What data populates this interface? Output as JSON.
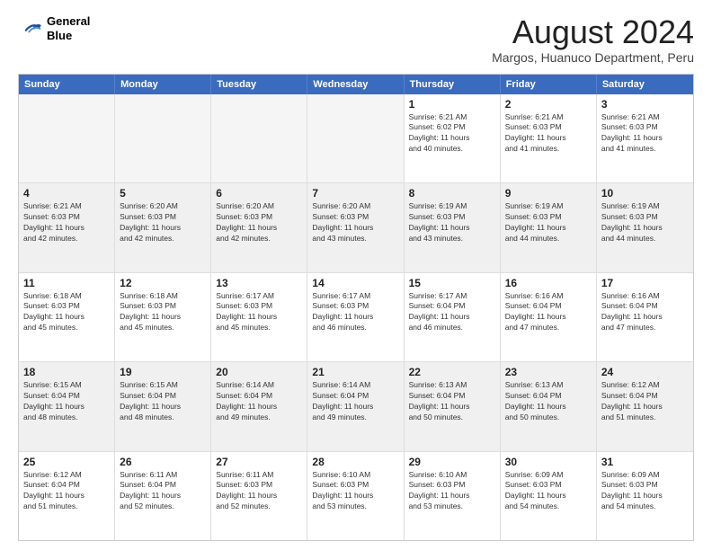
{
  "logo": {
    "line1": "General",
    "line2": "Blue"
  },
  "header": {
    "month": "August 2024",
    "location": "Margos, Huanuco Department, Peru"
  },
  "days": [
    "Sunday",
    "Monday",
    "Tuesday",
    "Wednesday",
    "Thursday",
    "Friday",
    "Saturday"
  ],
  "rows": [
    [
      {
        "day": "",
        "info": ""
      },
      {
        "day": "",
        "info": ""
      },
      {
        "day": "",
        "info": ""
      },
      {
        "day": "",
        "info": ""
      },
      {
        "day": "1",
        "info": "Sunrise: 6:21 AM\nSunset: 6:02 PM\nDaylight: 11 hours\nand 40 minutes."
      },
      {
        "day": "2",
        "info": "Sunrise: 6:21 AM\nSunset: 6:03 PM\nDaylight: 11 hours\nand 41 minutes."
      },
      {
        "day": "3",
        "info": "Sunrise: 6:21 AM\nSunset: 6:03 PM\nDaylight: 11 hours\nand 41 minutes."
      }
    ],
    [
      {
        "day": "4",
        "info": "Sunrise: 6:21 AM\nSunset: 6:03 PM\nDaylight: 11 hours\nand 42 minutes."
      },
      {
        "day": "5",
        "info": "Sunrise: 6:20 AM\nSunset: 6:03 PM\nDaylight: 11 hours\nand 42 minutes."
      },
      {
        "day": "6",
        "info": "Sunrise: 6:20 AM\nSunset: 6:03 PM\nDaylight: 11 hours\nand 42 minutes."
      },
      {
        "day": "7",
        "info": "Sunrise: 6:20 AM\nSunset: 6:03 PM\nDaylight: 11 hours\nand 43 minutes."
      },
      {
        "day": "8",
        "info": "Sunrise: 6:19 AM\nSunset: 6:03 PM\nDaylight: 11 hours\nand 43 minutes."
      },
      {
        "day": "9",
        "info": "Sunrise: 6:19 AM\nSunset: 6:03 PM\nDaylight: 11 hours\nand 44 minutes."
      },
      {
        "day": "10",
        "info": "Sunrise: 6:19 AM\nSunset: 6:03 PM\nDaylight: 11 hours\nand 44 minutes."
      }
    ],
    [
      {
        "day": "11",
        "info": "Sunrise: 6:18 AM\nSunset: 6:03 PM\nDaylight: 11 hours\nand 45 minutes."
      },
      {
        "day": "12",
        "info": "Sunrise: 6:18 AM\nSunset: 6:03 PM\nDaylight: 11 hours\nand 45 minutes."
      },
      {
        "day": "13",
        "info": "Sunrise: 6:17 AM\nSunset: 6:03 PM\nDaylight: 11 hours\nand 45 minutes."
      },
      {
        "day": "14",
        "info": "Sunrise: 6:17 AM\nSunset: 6:03 PM\nDaylight: 11 hours\nand 46 minutes."
      },
      {
        "day": "15",
        "info": "Sunrise: 6:17 AM\nSunset: 6:04 PM\nDaylight: 11 hours\nand 46 minutes."
      },
      {
        "day": "16",
        "info": "Sunrise: 6:16 AM\nSunset: 6:04 PM\nDaylight: 11 hours\nand 47 minutes."
      },
      {
        "day": "17",
        "info": "Sunrise: 6:16 AM\nSunset: 6:04 PM\nDaylight: 11 hours\nand 47 minutes."
      }
    ],
    [
      {
        "day": "18",
        "info": "Sunrise: 6:15 AM\nSunset: 6:04 PM\nDaylight: 11 hours\nand 48 minutes."
      },
      {
        "day": "19",
        "info": "Sunrise: 6:15 AM\nSunset: 6:04 PM\nDaylight: 11 hours\nand 48 minutes."
      },
      {
        "day": "20",
        "info": "Sunrise: 6:14 AM\nSunset: 6:04 PM\nDaylight: 11 hours\nand 49 minutes."
      },
      {
        "day": "21",
        "info": "Sunrise: 6:14 AM\nSunset: 6:04 PM\nDaylight: 11 hours\nand 49 minutes."
      },
      {
        "day": "22",
        "info": "Sunrise: 6:13 AM\nSunset: 6:04 PM\nDaylight: 11 hours\nand 50 minutes."
      },
      {
        "day": "23",
        "info": "Sunrise: 6:13 AM\nSunset: 6:04 PM\nDaylight: 11 hours\nand 50 minutes."
      },
      {
        "day": "24",
        "info": "Sunrise: 6:12 AM\nSunset: 6:04 PM\nDaylight: 11 hours\nand 51 minutes."
      }
    ],
    [
      {
        "day": "25",
        "info": "Sunrise: 6:12 AM\nSunset: 6:04 PM\nDaylight: 11 hours\nand 51 minutes."
      },
      {
        "day": "26",
        "info": "Sunrise: 6:11 AM\nSunset: 6:04 PM\nDaylight: 11 hours\nand 52 minutes."
      },
      {
        "day": "27",
        "info": "Sunrise: 6:11 AM\nSunset: 6:03 PM\nDaylight: 11 hours\nand 52 minutes."
      },
      {
        "day": "28",
        "info": "Sunrise: 6:10 AM\nSunset: 6:03 PM\nDaylight: 11 hours\nand 53 minutes."
      },
      {
        "day": "29",
        "info": "Sunrise: 6:10 AM\nSunset: 6:03 PM\nDaylight: 11 hours\nand 53 minutes."
      },
      {
        "day": "30",
        "info": "Sunrise: 6:09 AM\nSunset: 6:03 PM\nDaylight: 11 hours\nand 54 minutes."
      },
      {
        "day": "31",
        "info": "Sunrise: 6:09 AM\nSunset: 6:03 PM\nDaylight: 11 hours\nand 54 minutes."
      }
    ]
  ]
}
